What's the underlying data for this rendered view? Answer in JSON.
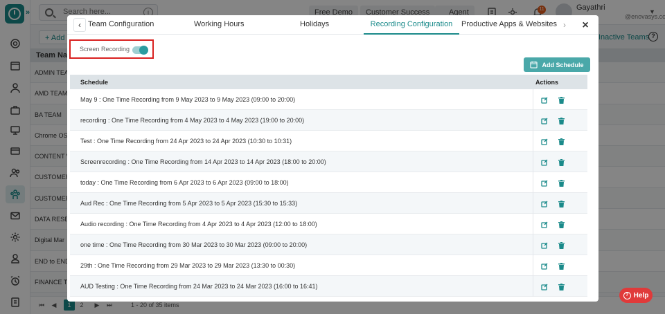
{
  "topbar": {
    "search_placeholder": "Search here...",
    "pills": [
      "Free Demo",
      "Customer Success",
      "Agent"
    ],
    "notification_count": "11",
    "user_name": "Gayathri",
    "user_email": "@enovasys.com"
  },
  "background": {
    "add_label": "+ Add",
    "inactive_label": "Inactive Teams",
    "table_header": "Team Nam",
    "rows": [
      "ADMIN TEAM",
      "AMD TEAM",
      "BA TEAM",
      "Chrome OS",
      "CONTENT W",
      "CUSTOMER",
      "CUSTOMER",
      "DATA RESEA",
      "Digital Mar",
      "END to END",
      "FINANCE TE"
    ],
    "pager": {
      "pages": [
        "1",
        "2"
      ],
      "info": "1 - 20 of 35 items"
    }
  },
  "modal": {
    "tabs": [
      "Team Configuration",
      "Working Hours",
      "Holidays",
      "Recording Configuration",
      "Productive Apps & Websites"
    ],
    "active_tab": "Recording Configuration",
    "close_label": "×",
    "toggle_label": "Screen Recording",
    "add_schedule_label": "Add Schedule",
    "columns": {
      "schedule": "Schedule",
      "actions": "Actions"
    },
    "schedules": [
      "May 9 : One Time Recording from 9 May 2023 to 9 May 2023 (09:00 to 20:00)",
      "recording : One Time Recording from 4 May 2023 to 4 May 2023 (19:00 to 20:00)",
      "Test : One Time Recording from 24 Apr 2023 to 24 Apr 2023 (10:30 to 10:31)",
      "Screenrecording : One Time Recording from 14 Apr 2023 to 14 Apr 2023 (18:00 to 20:00)",
      "today : One Time Recording from 6 Apr 2023 to 6 Apr 2023 (09:00 to 18:00)",
      "Aud Rec : One Time Recording from 5 Apr 2023 to 5 Apr 2023 (15:30 to 15:33)",
      "Audio recording : One Time Recording from 4 Apr 2023 to 4 Apr 2023 (12:00 to 18:00)",
      "one time : One Time Recording from 30 Mar 2023 to 30 Mar 2023 (09:00 to 20:00)",
      "29th : One Time Recording from 29 Mar 2023 to 29 Mar 2023 (13:30 to 00:30)",
      "AUD Testing : One Time Recording from 24 Mar 2023 to 24 Mar 2023 (16:00 to 16:41)"
    ]
  },
  "help_label": "Help",
  "colors": {
    "accent": "#1a8a8a",
    "highlight": "#d9201f",
    "help": "#e03a3a"
  }
}
